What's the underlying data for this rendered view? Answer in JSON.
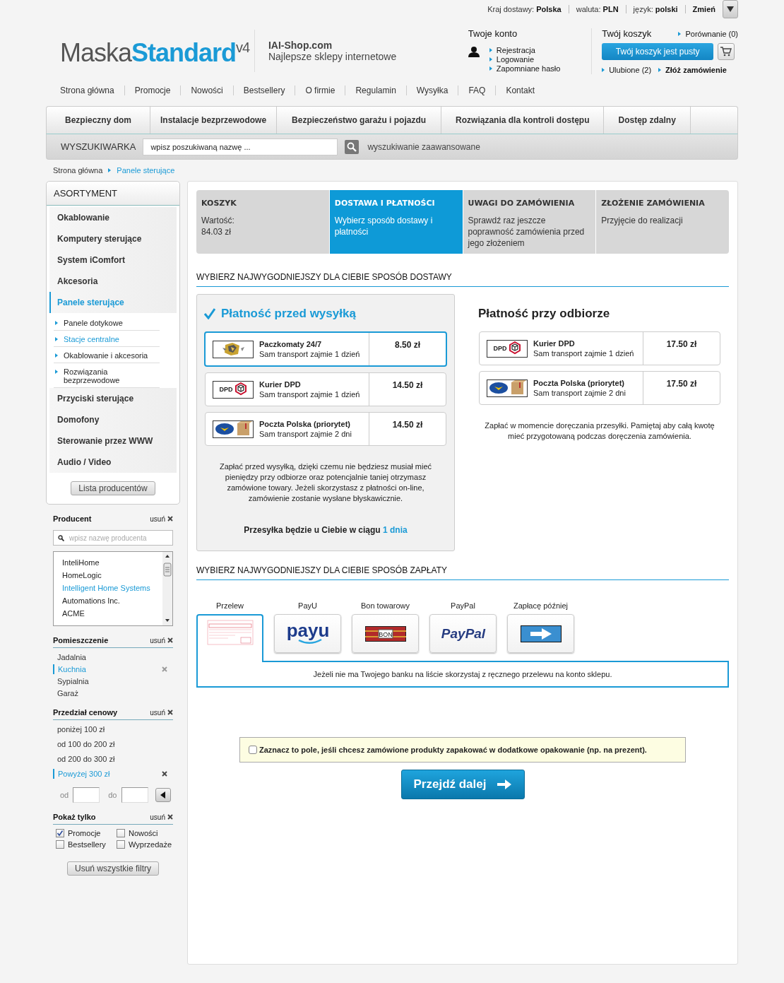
{
  "top_bar": {
    "items": [
      "Kraj dostawy: **Polska**",
      "waluta: **PLN**",
      "język: **polski**"
    ],
    "change": "Zmień"
  },
  "logo": {
    "part_a": "Maska",
    "part_b": "Standard",
    "version": "v4"
  },
  "tagline": {
    "title": "IAI-Shop.com",
    "subtitle": "Najlepsze sklepy internetowe"
  },
  "account": {
    "title": "Twoje konto",
    "links": [
      "Rejestracja",
      "Logowanie",
      "Zapomniane hasło"
    ]
  },
  "cart": {
    "title": "Twój koszyk",
    "compare": "Porównanie (0)",
    "button": "Twój koszyk jest pusty",
    "links": [
      {
        "label": "Ulubione (2)",
        "emphasized": false
      },
      {
        "label": "Złóż zamówienie",
        "emphasized": true
      }
    ]
  },
  "menu": [
    "Strona główna",
    "Promocje",
    "Nowości",
    "Bestsellery",
    "O firmie",
    "Regulamin",
    "Wysyłka",
    "FAQ",
    "Kontakt"
  ],
  "categories": [
    "Bezpieczny dom",
    "Instalacje bezprzewodowe",
    "Bezpieczeństwo garażu i pojazdu",
    "Rozwiązania dla  kontroli dostępu",
    "Dostęp zdalny"
  ],
  "search": {
    "label": "WYSZUKIWARKA",
    "placeholder": "wpisz poszukiwaną nazwę ...",
    "advanced": "wyszukiwanie zaawansowane"
  },
  "breadcrumb": [
    "Strona główna",
    "Panele sterujące"
  ],
  "assortment": {
    "title": "ASORTYMENT",
    "items": [
      {
        "label": "Okablowanie",
        "selected": false
      },
      {
        "label": "Komputery sterujące",
        "selected": false
      },
      {
        "label": "System iComfort",
        "selected": false
      },
      {
        "label": "Akcesoria",
        "selected": false
      },
      {
        "label": "Panele sterujące",
        "selected": true,
        "children": [
          {
            "label": "Panele dotykowe",
            "selected": false
          },
          {
            "label": "Stacje centralne",
            "selected": true
          },
          {
            "label": "Okablowanie i akcesoria",
            "selected": false
          },
          {
            "label": "Rozwiązania bezprzewodowe",
            "selected": false
          }
        ]
      },
      {
        "label": "Przyciski sterujące",
        "selected": false
      },
      {
        "label": "Domofony",
        "selected": false
      },
      {
        "label": "Sterowanie przez WWW",
        "selected": false
      },
      {
        "label": "Audio / Video",
        "selected": false
      }
    ],
    "button": "Lista producentów"
  },
  "filters": {
    "producer": {
      "title": "Producent",
      "remove": "usuń",
      "placeholder": "wpisz nazwę producenta",
      "items": [
        {
          "label": "InteliHome",
          "selected": false
        },
        {
          "label": "HomeLogic",
          "selected": false
        },
        {
          "label": "Intelligent Home Systems",
          "selected": true
        },
        {
          "label": "Automations Inc.",
          "selected": false
        },
        {
          "label": "ACME",
          "selected": false
        }
      ]
    },
    "rooms": {
      "title": "Pomieszczenie",
      "remove": "usuń",
      "items": [
        {
          "label": "Jadalnia",
          "selected": false
        },
        {
          "label": "Kuchnia",
          "selected": true
        },
        {
          "label": "Sypialnia",
          "selected": false
        },
        {
          "label": "Garaż",
          "selected": false
        }
      ]
    },
    "price": {
      "title": "Przedział cenowy",
      "remove": "usuń",
      "items": [
        {
          "label": "poniżej 100 zł",
          "selected": false
        },
        {
          "label": "od 100 do 200 zł",
          "selected": false
        },
        {
          "label": "od 200 do 300 zł",
          "selected": false
        },
        {
          "label": "Powyżej 300 zł",
          "selected": true
        }
      ],
      "from_label": "od",
      "to_label": "do"
    },
    "show_only": {
      "title": "Pokaż tylko",
      "remove": "usuń",
      "options": [
        {
          "label": "Promocje",
          "checked": true
        },
        {
          "label": "Nowości",
          "checked": false
        },
        {
          "label": "Bestsellery",
          "checked": false
        },
        {
          "label": "Wyprzedaże",
          "checked": false
        }
      ]
    },
    "clear_button": "Usuń wszystkie filtry"
  },
  "steps": [
    {
      "title": "KOSZYK",
      "text": "Wartość:\n84.03 zł",
      "selected": false
    },
    {
      "title": "DOSTAWA I PŁATNOŚCI",
      "text": "Wybierz sposób dostawy i płatności",
      "selected": true
    },
    {
      "title": "UWAGI DO ZAMÓWIENIA",
      "text": "Sprawdź raz jeszcze poprawność zamówienia przed jego złożeniem",
      "selected": false
    },
    {
      "title": "ZŁOŻENIE ZAMÓWIENIA",
      "text": "Przyjęcie do realizacji",
      "selected": false
    }
  ],
  "delivery": {
    "heading": "WYBIERZ NAJWYGODNIEJSZY DLA CIEBIE SPOSÓB DOSTAWY",
    "groups": [
      {
        "title": "Płatność przed wysyłką",
        "selected": true,
        "options": [
          {
            "name": "Paczkomaty 24/7",
            "time": "Sam transport zajmie 1 dzień",
            "price": "8.50 zł",
            "kind": "locker",
            "selected": true
          },
          {
            "name": "Kurier DPD",
            "time": "Sam transport zajmie 1 dzień",
            "price": "14.50 zł",
            "kind": "dpd",
            "logo_text": "DPD",
            "selected": false
          },
          {
            "name": "Poczta Polska (priorytet)",
            "time": "Sam transport zajmie 2 dni",
            "price": "14.50 zł",
            "kind": "post",
            "selected": false
          }
        ],
        "note": "Zapłać przed wysyłką, dzięki czemu nie będziesz musiał mieć pieniędzy przy odbiorze oraz potencjalnie taniej otrzymasz zamówione towary. Jeżeli skorzystasz z płatności on-line, zamówienie zostanie wysłane błyskawicznie.",
        "eta_prefix": "Przesyłka będzie u Ciebie w ciągu",
        "eta": "1 dnia"
      },
      {
        "title": "Płatność przy odbiorze",
        "selected": false,
        "options": [
          {
            "name": "Kurier DPD",
            "time": "Sam transport zajmie 1 dzień",
            "price": "17.50 zł",
            "kind": "dpd",
            "logo_text": "DPD",
            "selected": false
          },
          {
            "name": "Poczta Polska (priorytet)",
            "time": "Sam transport zajmie 2 dni",
            "price": "17.50 zł",
            "kind": "post",
            "selected": false
          }
        ],
        "note": "Zapłać w momencie doręczania przesyłki. Pamiętaj aby całą kwotę mieć przygotowaną podczas doręczenia zamówienia."
      }
    ]
  },
  "payment": {
    "heading": "WYBIERZ NAJWYGODNIEJSZY DLA CIEBIE SPOSÓB ZAPŁATY",
    "methods": [
      {
        "label": "Przelew",
        "kind": "transfer",
        "selected": true
      },
      {
        "label": "PayU",
        "kind": "payu",
        "logo_text": "payu",
        "selected": false
      },
      {
        "label": "Bon towarowy",
        "kind": "voucher",
        "logo_text": "BON",
        "selected": false
      },
      {
        "label": "PayPal",
        "kind": "paypal",
        "logo_text": "PayPal",
        "selected": false
      },
      {
        "label": "Zapłacę później",
        "kind": "later",
        "selected": false
      }
    ],
    "note": "Jeżeli nie ma Twojego banku na liście skorzystaj z ręcznego przelewu na konto sklepu."
  },
  "gift": {
    "label": "Zaznacz to pole, jeśli chcesz zamówione produkty zapakować w dodatkowe opakowanie (np. na prezent).",
    "checked": false
  },
  "next_button": "Przejdź dalej"
}
